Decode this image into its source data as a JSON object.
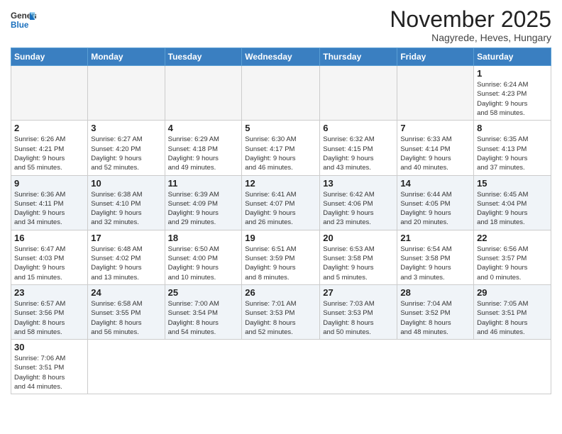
{
  "logo": {
    "line1": "General",
    "line2": "Blue"
  },
  "title": "November 2025",
  "location": "Nagyrede, Heves, Hungary",
  "weekdays": [
    "Sunday",
    "Monday",
    "Tuesday",
    "Wednesday",
    "Thursday",
    "Friday",
    "Saturday"
  ],
  "days": [
    {
      "num": "",
      "info": ""
    },
    {
      "num": "",
      "info": ""
    },
    {
      "num": "",
      "info": ""
    },
    {
      "num": "",
      "info": ""
    },
    {
      "num": "",
      "info": ""
    },
    {
      "num": "",
      "info": ""
    },
    {
      "num": "1",
      "info": "Sunrise: 6:24 AM\nSunset: 4:23 PM\nDaylight: 9 hours\nand 58 minutes."
    },
    {
      "num": "2",
      "info": "Sunrise: 6:26 AM\nSunset: 4:21 PM\nDaylight: 9 hours\nand 55 minutes."
    },
    {
      "num": "3",
      "info": "Sunrise: 6:27 AM\nSunset: 4:20 PM\nDaylight: 9 hours\nand 52 minutes."
    },
    {
      "num": "4",
      "info": "Sunrise: 6:29 AM\nSunset: 4:18 PM\nDaylight: 9 hours\nand 49 minutes."
    },
    {
      "num": "5",
      "info": "Sunrise: 6:30 AM\nSunset: 4:17 PM\nDaylight: 9 hours\nand 46 minutes."
    },
    {
      "num": "6",
      "info": "Sunrise: 6:32 AM\nSunset: 4:15 PM\nDaylight: 9 hours\nand 43 minutes."
    },
    {
      "num": "7",
      "info": "Sunrise: 6:33 AM\nSunset: 4:14 PM\nDaylight: 9 hours\nand 40 minutes."
    },
    {
      "num": "8",
      "info": "Sunrise: 6:35 AM\nSunset: 4:13 PM\nDaylight: 9 hours\nand 37 minutes."
    },
    {
      "num": "9",
      "info": "Sunrise: 6:36 AM\nSunset: 4:11 PM\nDaylight: 9 hours\nand 34 minutes."
    },
    {
      "num": "10",
      "info": "Sunrise: 6:38 AM\nSunset: 4:10 PM\nDaylight: 9 hours\nand 32 minutes."
    },
    {
      "num": "11",
      "info": "Sunrise: 6:39 AM\nSunset: 4:09 PM\nDaylight: 9 hours\nand 29 minutes."
    },
    {
      "num": "12",
      "info": "Sunrise: 6:41 AM\nSunset: 4:07 PM\nDaylight: 9 hours\nand 26 minutes."
    },
    {
      "num": "13",
      "info": "Sunrise: 6:42 AM\nSunset: 4:06 PM\nDaylight: 9 hours\nand 23 minutes."
    },
    {
      "num": "14",
      "info": "Sunrise: 6:44 AM\nSunset: 4:05 PM\nDaylight: 9 hours\nand 20 minutes."
    },
    {
      "num": "15",
      "info": "Sunrise: 6:45 AM\nSunset: 4:04 PM\nDaylight: 9 hours\nand 18 minutes."
    },
    {
      "num": "16",
      "info": "Sunrise: 6:47 AM\nSunset: 4:03 PM\nDaylight: 9 hours\nand 15 minutes."
    },
    {
      "num": "17",
      "info": "Sunrise: 6:48 AM\nSunset: 4:02 PM\nDaylight: 9 hours\nand 13 minutes."
    },
    {
      "num": "18",
      "info": "Sunrise: 6:50 AM\nSunset: 4:00 PM\nDaylight: 9 hours\nand 10 minutes."
    },
    {
      "num": "19",
      "info": "Sunrise: 6:51 AM\nSunset: 3:59 PM\nDaylight: 9 hours\nand 8 minutes."
    },
    {
      "num": "20",
      "info": "Sunrise: 6:53 AM\nSunset: 3:58 PM\nDaylight: 9 hours\nand 5 minutes."
    },
    {
      "num": "21",
      "info": "Sunrise: 6:54 AM\nSunset: 3:58 PM\nDaylight: 9 hours\nand 3 minutes."
    },
    {
      "num": "22",
      "info": "Sunrise: 6:56 AM\nSunset: 3:57 PM\nDaylight: 9 hours\nand 0 minutes."
    },
    {
      "num": "23",
      "info": "Sunrise: 6:57 AM\nSunset: 3:56 PM\nDaylight: 8 hours\nand 58 minutes."
    },
    {
      "num": "24",
      "info": "Sunrise: 6:58 AM\nSunset: 3:55 PM\nDaylight: 8 hours\nand 56 minutes."
    },
    {
      "num": "25",
      "info": "Sunrise: 7:00 AM\nSunset: 3:54 PM\nDaylight: 8 hours\nand 54 minutes."
    },
    {
      "num": "26",
      "info": "Sunrise: 7:01 AM\nSunset: 3:53 PM\nDaylight: 8 hours\nand 52 minutes."
    },
    {
      "num": "27",
      "info": "Sunrise: 7:03 AM\nSunset: 3:53 PM\nDaylight: 8 hours\nand 50 minutes."
    },
    {
      "num": "28",
      "info": "Sunrise: 7:04 AM\nSunset: 3:52 PM\nDaylight: 8 hours\nand 48 minutes."
    },
    {
      "num": "29",
      "info": "Sunrise: 7:05 AM\nSunset: 3:51 PM\nDaylight: 8 hours\nand 46 minutes."
    },
    {
      "num": "30",
      "info": "Sunrise: 7:06 AM\nSunset: 3:51 PM\nDaylight: 8 hours\nand 44 minutes."
    }
  ]
}
